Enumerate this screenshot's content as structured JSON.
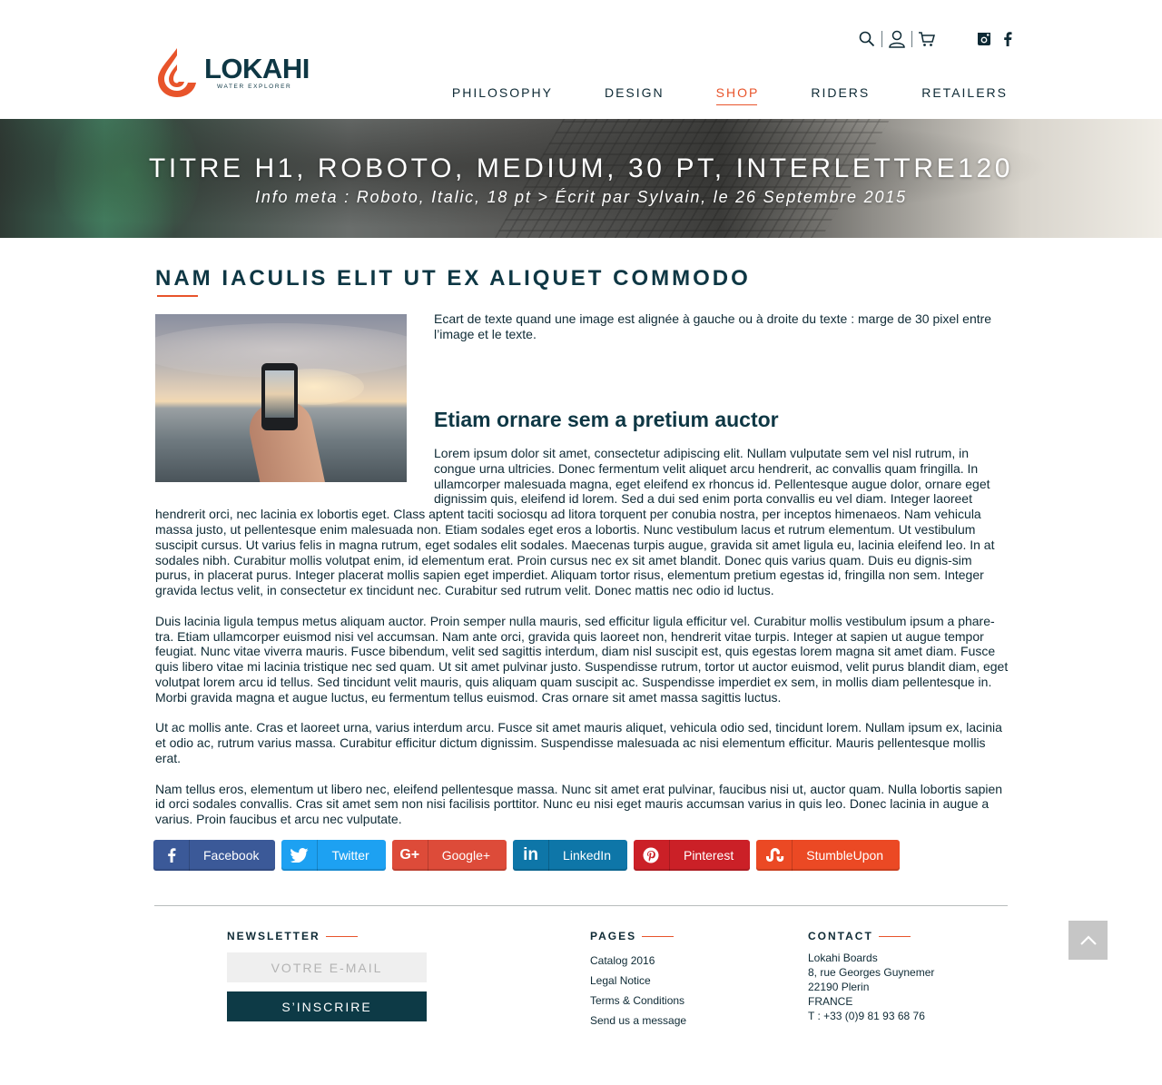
{
  "brand": {
    "name": "LOKAHI",
    "tagline": "WATER EXPLORER",
    "accent": "#e8542b",
    "dark": "#0e3744"
  },
  "header_icons": [
    "search-icon",
    "user-icon",
    "cart-icon"
  ],
  "social_top": [
    "instagram-icon",
    "facebook-icon"
  ],
  "nav": [
    {
      "label": "PHILOSOPHY",
      "active": false
    },
    {
      "label": "DESIGN",
      "active": false
    },
    {
      "label": "SHOP",
      "active": true
    },
    {
      "label": "RIDERS",
      "active": false
    },
    {
      "label": "RETAILERS",
      "active": false
    }
  ],
  "hero": {
    "title": "TITRE H1, ROBOTO, MEDIUM, 30 PT, INTERLETTRE120",
    "meta": "Info meta : Roboto, Italic, 18 pt > Écrit par Sylvain, le 26 Septembre 2015"
  },
  "article": {
    "heading": "NAM IACULIS ELIT UT EX ALIQUET COMMODO",
    "intro": "Ecart de texte quand une image est alignée à gauche ou à droite du texte : marge de 30 pixel entre l’image et le texte.",
    "subheading": "Etiam ornare sem a pretium auctor",
    "paragraphs": [
      "Lorem ipsum dolor sit amet, consectetur adipiscing elit. Nullam vulputate sem vel nisl rutrum, in congue urna ultricies. Donec fermentum velit aliquet arcu hendrerit, ac convallis quam fringilla. In ullamcorper malesuada magna, eget eleifend ex rhoncus id. Pellentesque augue dolor, ornare eget dignissim quis, eleifend id lorem. Sed a dui sed enim porta convallis eu vel diam. Integer laoreet hendrerit orci, nec lacinia ex lobortis eget. Class aptent taciti sociosqu ad litora torquent per conubia nostra, per inceptos himenaeos. Nam vehicula massa justo, ut pellentesque enim malesuada non. Etiam sodales eget eros a lobortis. Nunc vestibulum lacus et rutrum elementum. Ut vestibulum suscipit cursus. Ut varius felis in magna rutrum, eget sodales elit sodales. Maecenas turpis augue, gravida sit amet ligula eu, lacinia eleifend leo. In at sodales nibh. Curabitur mollis volutpat enim, id elementum erat. Proin cursus nec ex sit amet blandit. Donec quis varius quam. Duis eu dignis-sim purus, in placerat purus. Integer placerat mollis sapien eget imperdiet. Aliquam tortor risus, elementum pretium egestas id, fringilla non sem. Integer gravida lectus velit, in consectetur ex tincidunt nec. Curabitur sed rutrum velit. Donec mattis nec odio id luctus.",
      "Duis lacinia ligula tempus metus aliquam auctor. Proin semper nulla mauris, sed efficitur ligula efficitur vel. Curabitur mollis vestibulum ipsum a phare-tra. Etiam ullamcorper euismod nisi vel accumsan. Nam ante orci, gravida quis laoreet non, hendrerit vitae turpis. Integer at sapien ut augue tempor feugiat. Nunc vitae viverra mauris. Fusce bibendum, velit sed sagittis interdum, diam nisl suscipit est, quis egestas lorem magna sit amet diam. Fusce quis libero vitae mi lacinia tristique nec sed quam. Ut sit amet pulvinar justo. Suspendisse rutrum, tortor ut auctor euismod, velit purus blandit diam, eget volutpat lorem arcu id tellus. Sed tincidunt velit mauris, quis aliquam quam suscipit ac. Suspendisse imperdiet ex sem, in mollis diam pellentesque in. Morbi gravida magna et augue luctus, eu fermentum tellus euismod. Cras ornare sit amet massa sagittis luctus.",
      "Ut ac mollis ante. Cras et laoreet urna, varius interdum arcu. Fusce sit amet mauris aliquet, vehicula odio sed, tincidunt lorem. Nullam ipsum ex, lacinia et odio ac, rutrum varius massa. Curabitur efficitur dictum dignissim. Suspendisse malesuada ac nisi elementum efficitur. Mauris pellentesque mollis erat.",
      "Nam tellus eros, elementum ut libero nec, eleifend pellentesque massa. Nunc sit amet erat pulvinar, faucibus nisi ut, auctor quam. Nulla lobortis sapien id orci sodales convallis. Cras sit amet sem non nisi facilisis porttitor. Nunc eu nisi eget mauris accumsan varius in quis leo. Donec lacinia in augue a varius. Proin faucibus et arcu nec vulputate."
    ]
  },
  "share": [
    {
      "label": "Facebook",
      "icon": "facebook-icon",
      "color": "#3b5998"
    },
    {
      "label": "Twitter",
      "icon": "twitter-icon",
      "color": "#1da1f2"
    },
    {
      "label": "Google+",
      "icon": "google-plus-icon",
      "color": "#dd4b39"
    },
    {
      "label": "LinkedIn",
      "icon": "linkedin-icon",
      "color": "#0e76a8"
    },
    {
      "label": "Pinterest",
      "icon": "pinterest-icon",
      "color": "#cb2027"
    },
    {
      "label": "StumbleUpon",
      "icon": "stumbleupon-icon",
      "color": "#eb4924"
    }
  ],
  "footer": {
    "newsletter": {
      "title": "NEWSLETTER",
      "placeholder": "VOTRE E-MAIL",
      "button": "S’INSCRIRE"
    },
    "pages": {
      "title": "PAGES",
      "links": [
        "Catalog 2016",
        "Legal Notice",
        "Terms & Conditions",
        "Send us a message"
      ]
    },
    "contact": {
      "title": "CONTACT",
      "lines": [
        "Lokahi Boards",
        "8, rue Georges Guynemer",
        "22190 Plerin",
        "FRANCE",
        "T : +33 (0)9 81 93 68 76"
      ]
    }
  }
}
